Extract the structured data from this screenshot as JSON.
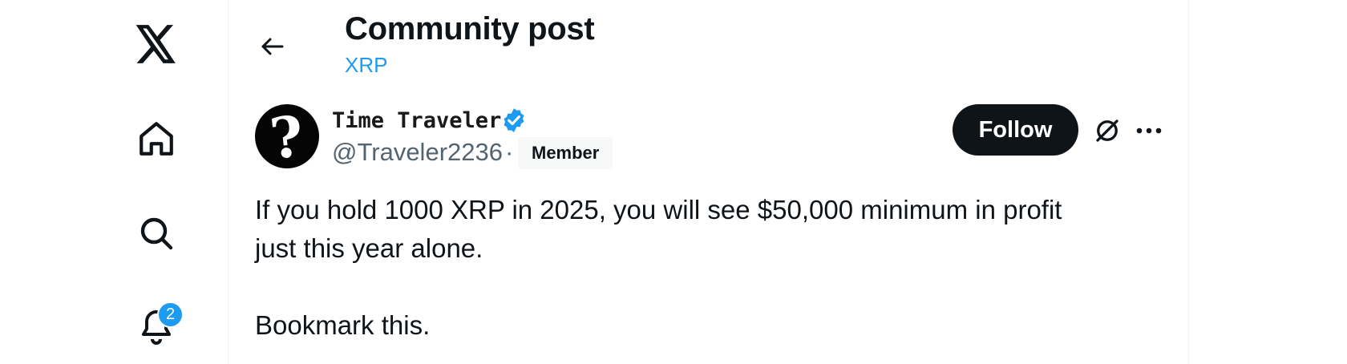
{
  "nav": {
    "logo_icon": "x-logo-icon",
    "items": [
      {
        "name": "home",
        "icon": "home-icon"
      },
      {
        "name": "search",
        "icon": "search-icon"
      },
      {
        "name": "notifications",
        "icon": "bell-icon",
        "badge": "2"
      }
    ]
  },
  "header": {
    "title": "Community post",
    "community": "XRP"
  },
  "post": {
    "author": {
      "display_name": "Time Traveler",
      "handle": "@Traveler2236",
      "separator": "·",
      "verified": true,
      "role_badge": "Member",
      "avatar_glyph": "?"
    },
    "follow_label": "Follow",
    "text_lines": [
      "If you hold 1000 XRP in 2025, you will see $50,000 minimum in profit",
      "just this year alone."
    ],
    "text_line_2": "Bookmark this."
  },
  "colors": {
    "accent": "#1d9bf0",
    "text": "#0f1419",
    "muted": "#536471",
    "button_bg": "#0f1419"
  }
}
